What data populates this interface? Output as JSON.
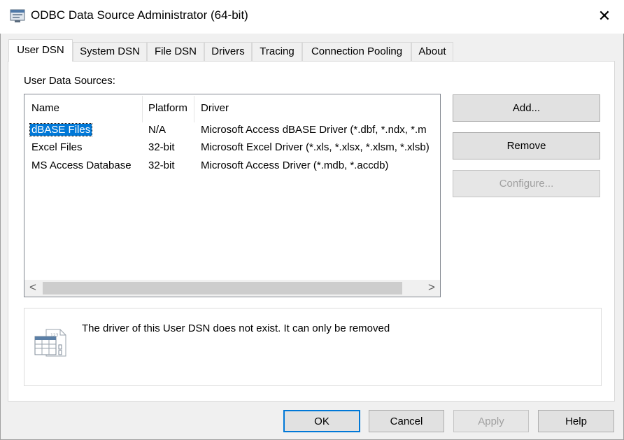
{
  "window": {
    "title": "ODBC Data Source Administrator (64-bit)",
    "app_icon": "odbc-admin-icon",
    "close_glyph": "✕"
  },
  "tabs": [
    {
      "label": "User DSN",
      "active": true
    },
    {
      "label": "System DSN",
      "active": false
    },
    {
      "label": "File DSN",
      "active": false
    },
    {
      "label": "Drivers",
      "active": false
    },
    {
      "label": "Tracing",
      "active": false
    },
    {
      "label": "Connection Pooling",
      "active": false
    },
    {
      "label": "About",
      "active": false
    }
  ],
  "user_dsn": {
    "section_label": "User Data Sources:",
    "columns": [
      "Name",
      "Platform",
      "Driver"
    ],
    "rows": [
      {
        "name": "dBASE Files",
        "platform": "N/A",
        "driver": "Microsoft Access dBASE Driver (*.dbf, *.ndx, *.m",
        "selected": true
      },
      {
        "name": "Excel Files",
        "platform": "32-bit",
        "driver": "Microsoft Excel Driver (*.xls, *.xlsx, *.xlsm, *.xlsb)",
        "selected": false
      },
      {
        "name": "MS Access Database",
        "platform": "32-bit",
        "driver": "Microsoft Access Driver (*.mdb, *.accdb)",
        "selected": false
      }
    ],
    "scroll_left_glyph": "<",
    "scroll_right_glyph": ">",
    "buttons": {
      "add": "Add...",
      "remove": "Remove",
      "configure": "Configure..."
    },
    "description": "The driver of this User DSN does not exist. It can only be removed",
    "description_icon": "data-source-document-icon"
  },
  "footer": {
    "ok": "OK",
    "cancel": "Cancel",
    "apply": "Apply",
    "help": "Help"
  },
  "colors": {
    "selection": "#0078d7",
    "default_button_border": "#0078d7",
    "disabled_text": "#a0a0a0",
    "window_bg": "#f0f0f0"
  }
}
